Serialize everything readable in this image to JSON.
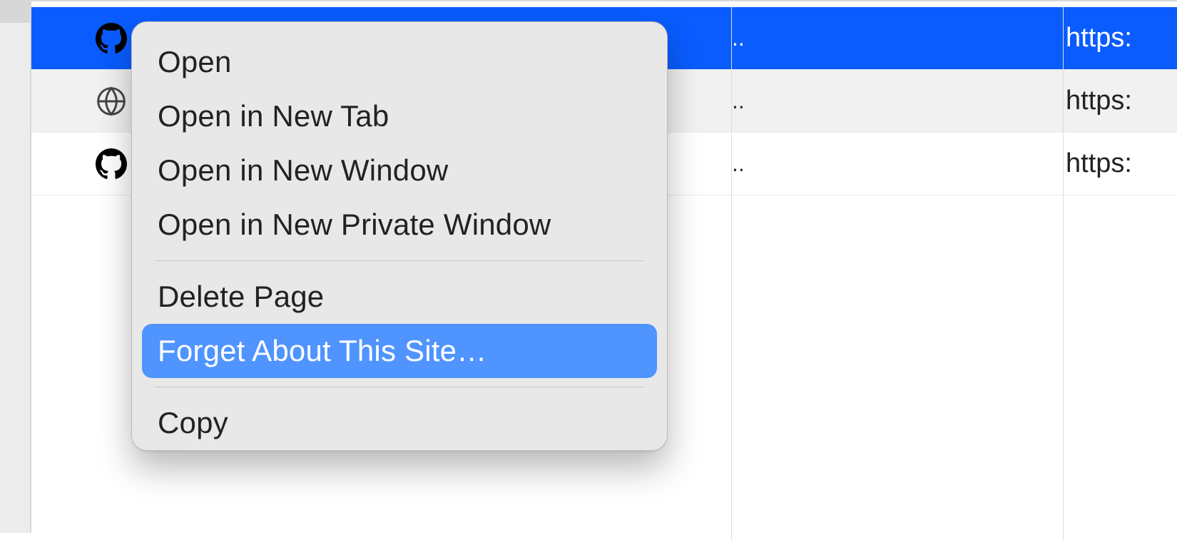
{
  "history": {
    "rows": [
      {
        "icon": "github",
        "ellipsis": "..",
        "url_fragment": "https:"
      },
      {
        "icon": "globe",
        "ellipsis": "..",
        "url_fragment": "https:"
      },
      {
        "icon": "github",
        "ellipsis": "..",
        "url_fragment": "https:"
      }
    ]
  },
  "context_menu": {
    "items": {
      "open": "Open",
      "open_new_tab": "Open in New Tab",
      "open_new_window": "Open in New Window",
      "open_private": "Open in New Private Window",
      "delete_page": "Delete Page",
      "forget_site": "Forget About This Site…",
      "copy": "Copy"
    },
    "highlighted": "forget_site"
  },
  "colors": {
    "selection": "#0a5cff",
    "menu_highlight": "#4f94ff",
    "menu_bg": "#e8e8e8"
  }
}
